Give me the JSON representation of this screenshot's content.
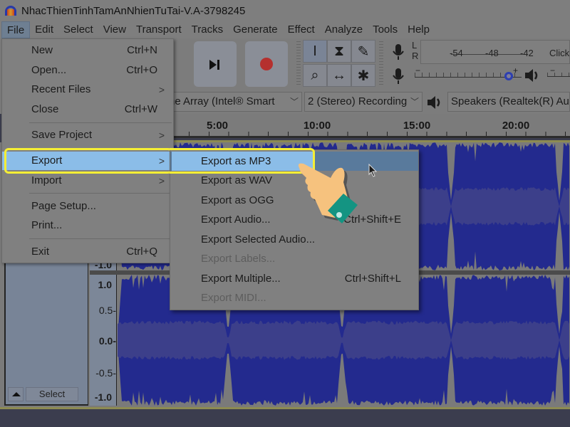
{
  "window": {
    "title": "NhacThienTinhTamAnNhienTuTai-V.A-3798245",
    "app_icon": "audacity-headphones-icon"
  },
  "menubar": {
    "items": [
      "File",
      "Edit",
      "Select",
      "View",
      "Transport",
      "Tracks",
      "Generate",
      "Effect",
      "Analyze",
      "Tools",
      "Help"
    ],
    "active": "File"
  },
  "toolbar": {
    "transport": [
      {
        "name": "skip-to-end",
        "icon": "skip-end-icon"
      },
      {
        "name": "record",
        "icon": "record-icon",
        "color": "#b5302e"
      }
    ],
    "tools": [
      {
        "name": "selection-tool",
        "icon": "I-beam-icon",
        "glyph": "I",
        "selected": true
      },
      {
        "name": "envelope-tool",
        "icon": "envelope-icon",
        "glyph": "⧗"
      },
      {
        "name": "draw-tool",
        "icon": "pencil-icon",
        "glyph": "✎"
      },
      {
        "name": "zoom-tool",
        "icon": "magnifier-icon",
        "glyph": "⌕"
      },
      {
        "name": "timeshift-tool",
        "icon": "double-arrow-icon",
        "glyph": "↔"
      },
      {
        "name": "multi-tool",
        "icon": "asterisk-icon",
        "glyph": "✱"
      }
    ],
    "meter": {
      "channels": [
        "L",
        "R"
      ],
      "ticks": [
        "-54",
        "-48",
        "-42"
      ],
      "hint": "Click"
    },
    "recording_volume": {
      "minus": "−",
      "plus": "+",
      "level": 0.88,
      "thumb_color": "#2d3fb0"
    }
  },
  "devicebar": {
    "input_device": "ne Array (Intel® Smart",
    "channels": "2 (Stereo) Recording",
    "output_device": "Speakers (Realtek(R) Audi"
  },
  "ruler": {
    "labels": [
      "5:00",
      "10:00",
      "15:00",
      "20:00"
    ]
  },
  "track": {
    "select_label": "Select",
    "scale_top": [
      "-1.0"
    ],
    "scale_bottom": [
      "1.0",
      "0.5-",
      "0.0-",
      "-0.5-",
      "-1.0"
    ],
    "wave_color": "#232a8e",
    "rms_color": "#3c3f8a"
  },
  "file_menu": {
    "items": [
      {
        "label": "New",
        "shortcut": "Ctrl+N"
      },
      {
        "label": "Open...",
        "shortcut": "Ctrl+O"
      },
      {
        "label": "Recent Files",
        "submenu": true
      },
      {
        "label": "Close",
        "shortcut": "Ctrl+W"
      },
      {
        "label": "Save Project",
        "submenu": true
      },
      {
        "label": "Export",
        "submenu": true,
        "highlighted": true
      },
      {
        "label": "Import",
        "submenu": true
      },
      {
        "label": "Page Setup..."
      },
      {
        "label": "Print..."
      },
      {
        "label": "Exit",
        "shortcut": "Ctrl+Q"
      }
    ],
    "arrow_glyph": ">"
  },
  "export_menu": {
    "items": [
      {
        "label": "Export as MP3",
        "highlighted": true
      },
      {
        "label": "Export as WAV"
      },
      {
        "label": "Export as OGG"
      },
      {
        "label": "Export Audio...",
        "shortcut": "Ctrl+Shift+E"
      },
      {
        "label": "Export Selected Audio..."
      },
      {
        "label": "Export Labels...",
        "disabled": true
      },
      {
        "label": "Export Multiple...",
        "shortcut": "Ctrl+Shift+L"
      },
      {
        "label": "Export MIDI...",
        "disabled": true
      }
    ]
  },
  "annotation": {
    "highlight_color": "#f5ee35",
    "pointer": "hand-pointer-icon"
  }
}
